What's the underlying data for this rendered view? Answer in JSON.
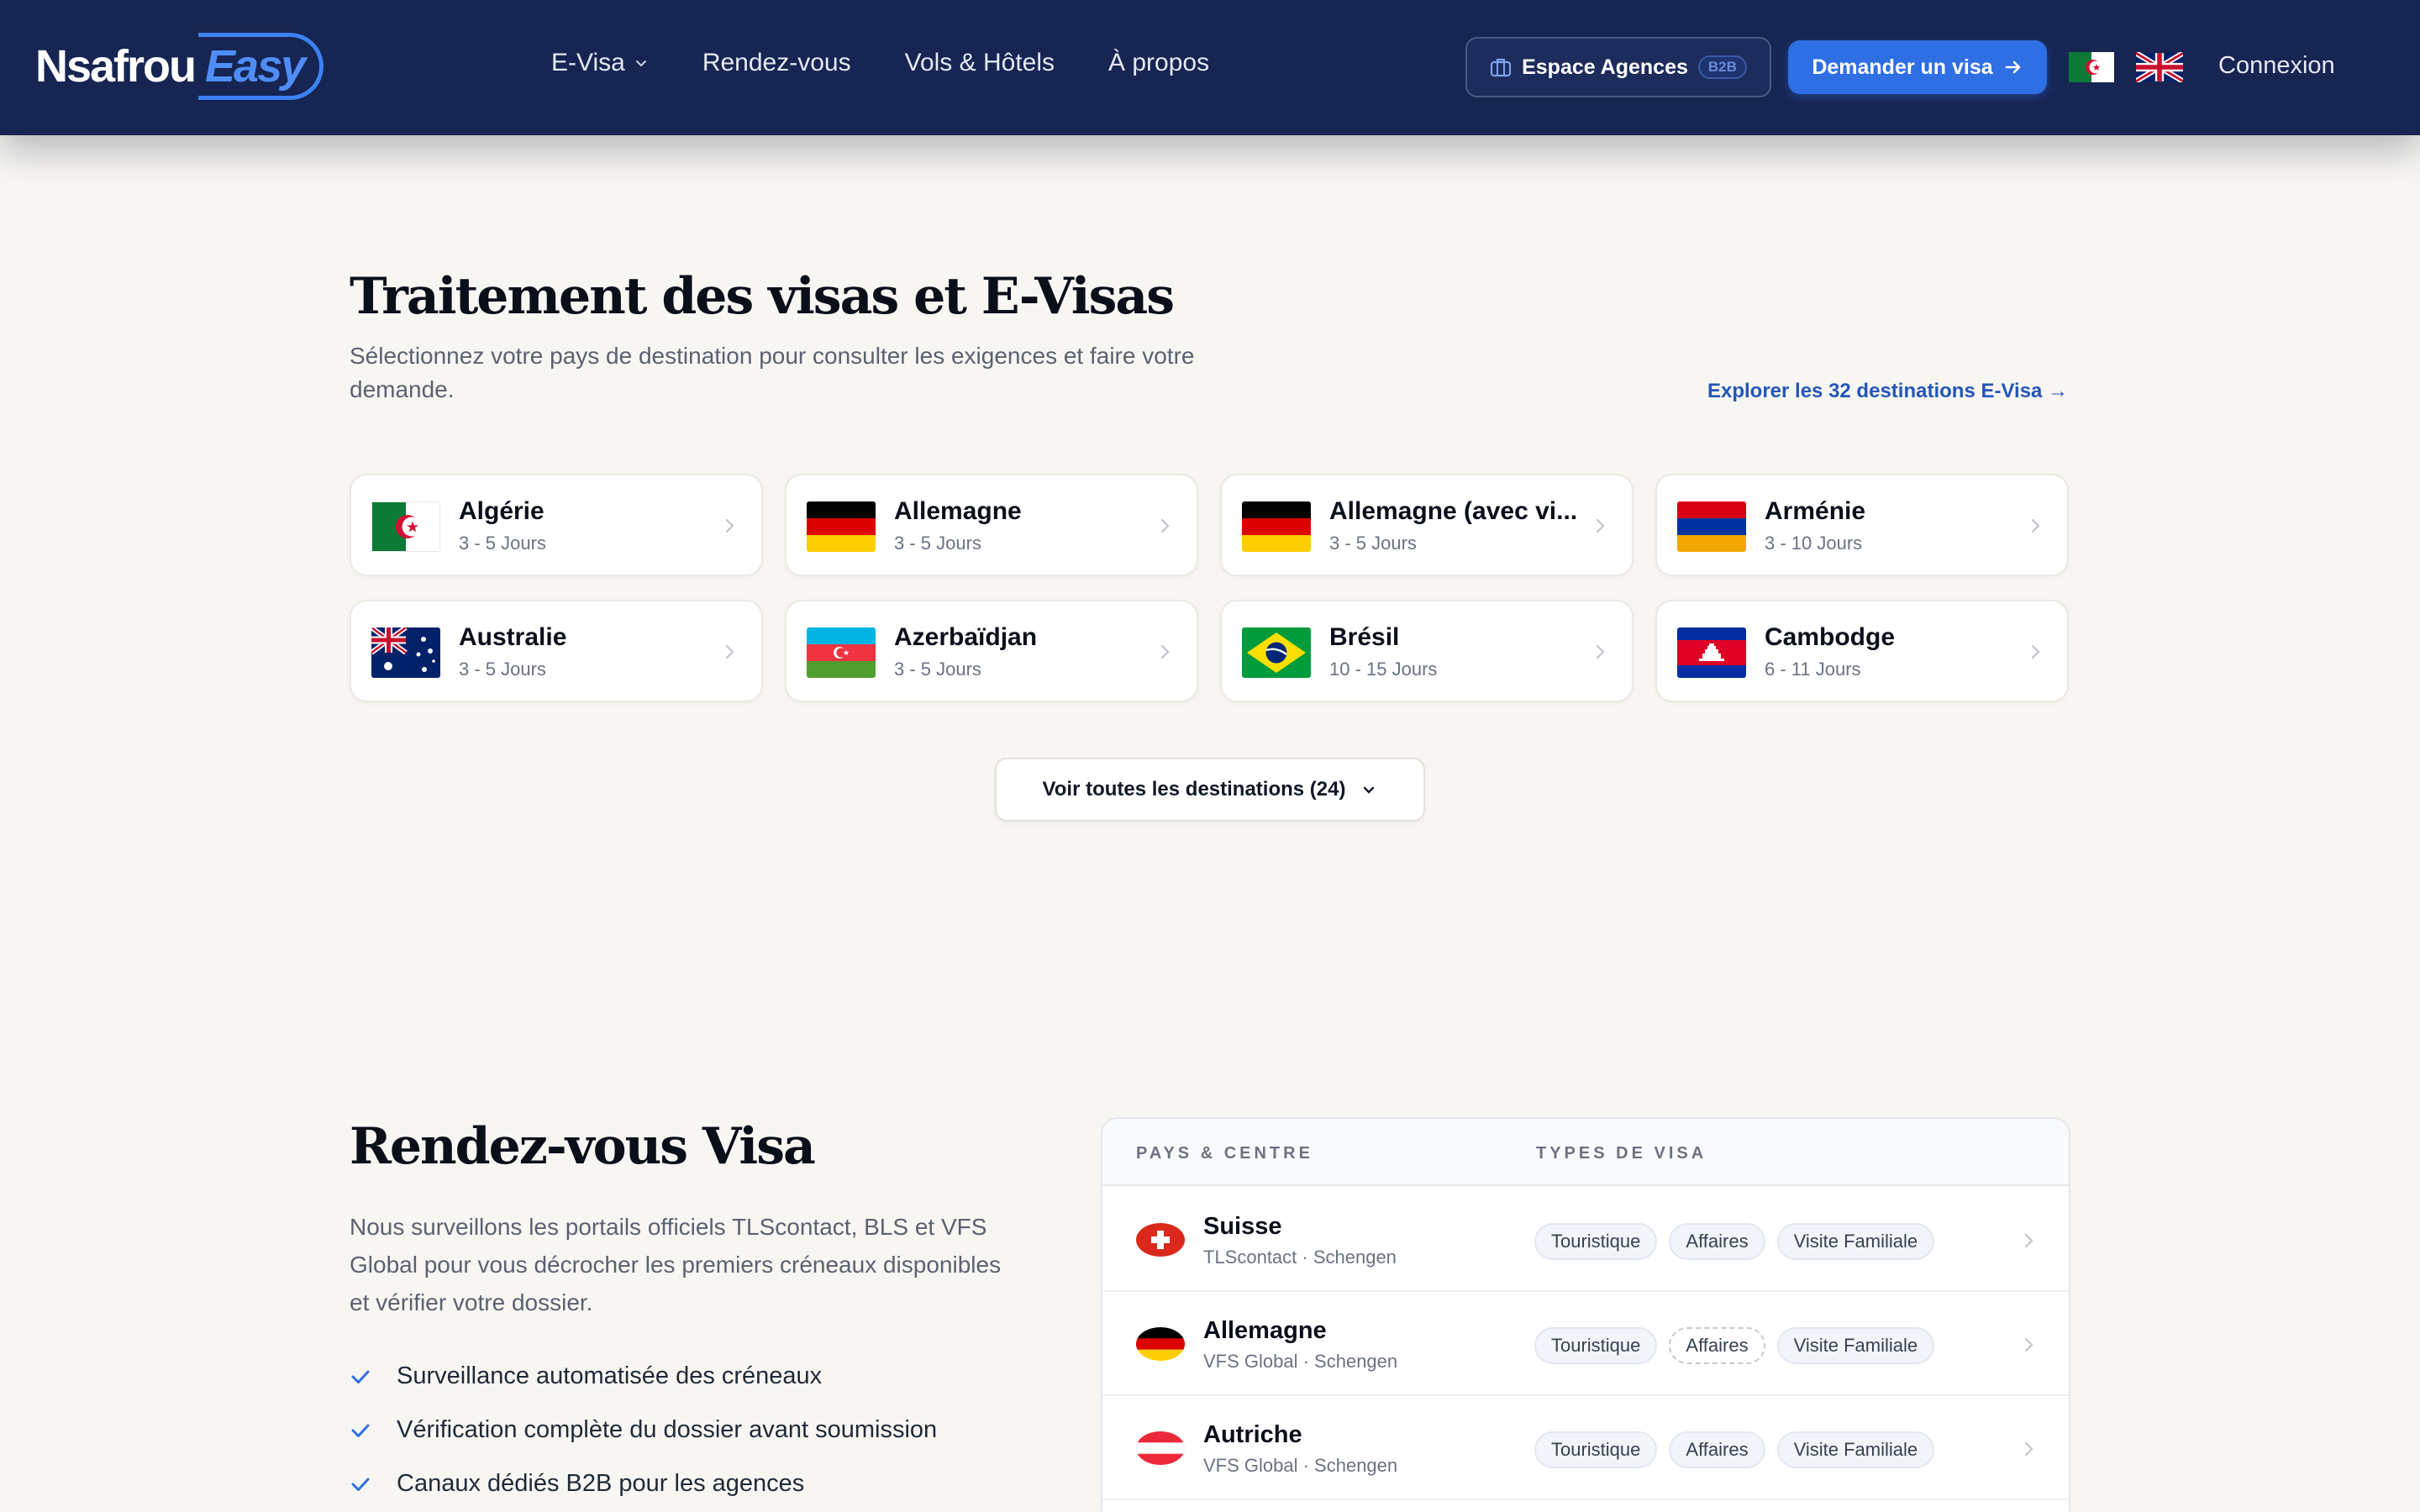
{
  "nav": {
    "logo_main": "Nsafrou",
    "logo_accent": "Easy",
    "links": [
      {
        "label": "E-Visa",
        "has_dropdown": true
      },
      {
        "label": "Rendez-vous"
      },
      {
        "label": "Vols & Hôtels"
      },
      {
        "label": "À propos"
      }
    ],
    "b2b_label": "Espace Agences",
    "b2b_badge": "B2B",
    "visa_button": "Demander un visa",
    "login": "Connexion",
    "languages": [
      "dz-flag",
      "uk-flag"
    ]
  },
  "evisa": {
    "title": "Traitement des visas et E-Visas",
    "subtitle": "Sélectionnez votre pays de destination pour consulter les exigences et faire votre demande.",
    "explore_link": "Explorer les 32 destinations E-Visa →",
    "destinations": [
      {
        "name": "Algérie",
        "days": "3 - 5 Jours",
        "flag": "dz"
      },
      {
        "name": "Allemagne",
        "days": "3 - 5 Jours",
        "flag": "de"
      },
      {
        "name": "Allemagne (avec vi...",
        "days": "3 - 5 Jours",
        "flag": "de"
      },
      {
        "name": "Arménie",
        "days": "3 - 10 Jours",
        "flag": "am"
      },
      {
        "name": "Australie",
        "days": "3 - 5 Jours",
        "flag": "au"
      },
      {
        "name": "Azerbaïdjan",
        "days": "3 - 5 Jours",
        "flag": "az"
      },
      {
        "name": "Brésil",
        "days": "10 - 15 Jours",
        "flag": "br"
      },
      {
        "name": "Cambodge",
        "days": "6 - 11 Jours",
        "flag": "kh"
      }
    ],
    "see_all": "Voir toutes les destinations (24)"
  },
  "appointments": {
    "title": "Rendez-vous Visa",
    "subtitle": "Nous surveillons les portails officiels TLScontact, BLS et VFS Global pour vous décrocher les premiers créneaux disponibles et vérifier votre dossier.",
    "features": [
      "Surveillance automatisée des créneaux",
      "Vérification complète du dossier avant soumission",
      "Canaux dédiés B2B pour les agences"
    ],
    "table": {
      "col_country": "PAYS & CENTRE",
      "col_types": "TYPES DE VISA",
      "rows": [
        {
          "country": "Suisse",
          "center": "TLScontact · Schengen",
          "flag": "ch",
          "types": [
            {
              "label": "Touristique",
              "available": true
            },
            {
              "label": "Affaires",
              "available": true
            },
            {
              "label": "Visite Familiale",
              "available": true
            }
          ]
        },
        {
          "country": "Allemagne",
          "center": "VFS Global · Schengen",
          "flag": "de",
          "types": [
            {
              "label": "Touristique",
              "available": true
            },
            {
              "label": "Affaires",
              "available": false
            },
            {
              "label": "Visite Familiale",
              "available": true
            }
          ]
        },
        {
          "country": "Autriche",
          "center": "VFS Global · Schengen",
          "flag": "at",
          "types": [
            {
              "label": "Touristique",
              "available": true
            },
            {
              "label": "Affaires",
              "available": true
            },
            {
              "label": "Visite Familiale",
              "available": true
            }
          ]
        }
      ]
    }
  },
  "colors": {
    "nav_bg": "#162552",
    "accent": "#2f6fe4",
    "page_bg": "#f8f6f2",
    "link": "#2456b8"
  }
}
